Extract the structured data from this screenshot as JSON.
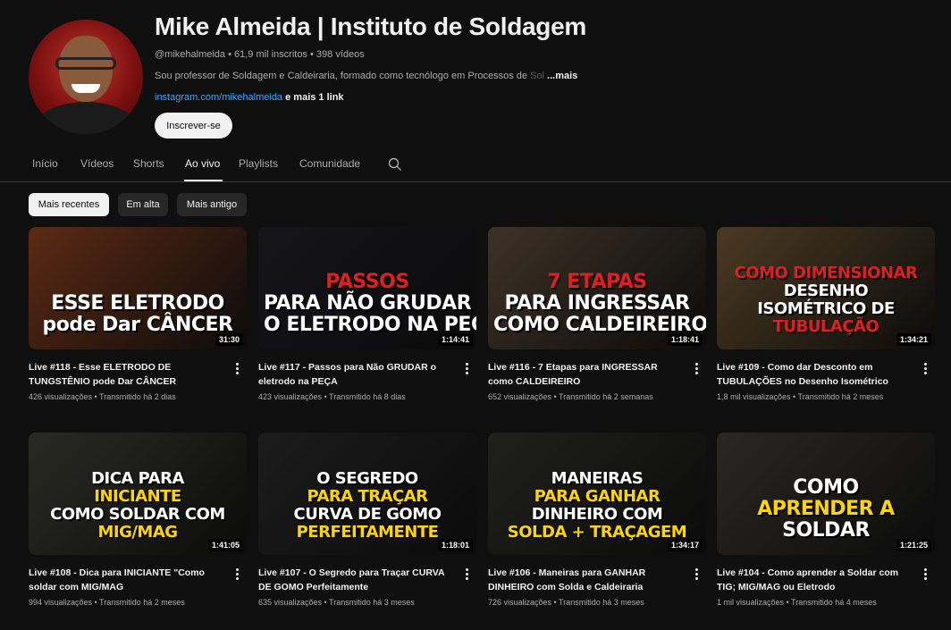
{
  "channel": {
    "name": "Mike Almeida | Instituto de Soldagem",
    "handle": "@mikehalmeida",
    "subscribers": "61,9 mil inscritos",
    "videos": "398 vídeos",
    "description": "Sou professor de Soldagem e Caldeiraria, formado como tecnólogo em Processos de",
    "description_fade": " Sol",
    "more_label": "...mais",
    "link": "instagram.com/mikehalmeida",
    "link_extra": "e mais 1 link",
    "subscribe_label": "Inscrever-se"
  },
  "tabs": [
    {
      "label": "Início"
    },
    {
      "label": "Vídeos"
    },
    {
      "label": "Shorts"
    },
    {
      "label": "Ao vivo"
    },
    {
      "label": "Playlists"
    },
    {
      "label": "Comunidade"
    }
  ],
  "active_tab": "Ao vivo",
  "chips": [
    {
      "label": "Mais recentes"
    },
    {
      "label": "Em alta"
    },
    {
      "label": "Mais antigo"
    }
  ],
  "videos": [
    {
      "title": "Live #118 - Esse ELETRODO DE TUNGSTÊNIO pode Dar CÂNCER",
      "views": "426 visualizações",
      "when": "Transmitido há 2 dias",
      "duration": "31:30",
      "thumb": {
        "bg": "#5c2a14",
        "lines": [
          {
            "text": "ESSE ELETRODO",
            "color": "#ffffff"
          },
          {
            "text": "pode Dar CÂNCER",
            "color": "#ffffff"
          }
        ]
      }
    },
    {
      "title": "Live #117 - Passos para Não GRUDAR o eletrodo na PEÇA",
      "views": "423 visualizações",
      "when": "Transmitido há 8 dias",
      "duration": "1:14:41",
      "thumb": {
        "bg": "#15151b",
        "lines": [
          {
            "text": "PASSOS",
            "color": "#e02020"
          },
          {
            "text": "PARA NÃO GRUDAR",
            "color": "#ffffff"
          },
          {
            "text": "O ELETRODO NA PEÇA",
            "color": "#ffffff"
          }
        ]
      }
    },
    {
      "title": "Live #116 - 7 Etapas para INGRESSAR como CALDEIREIRO",
      "views": "652 visualizações",
      "when": "Transmitido há 2 semanas",
      "duration": "1:18:41",
      "thumb": {
        "bg": "#3e3226",
        "lines": [
          {
            "text": "7 ETAPAS",
            "color": "#e02020"
          },
          {
            "text": "PARA INGRESSAR",
            "color": "#ffffff"
          },
          {
            "text": "COMO CALDEIREIRO",
            "color": "#ffffff"
          }
        ]
      }
    },
    {
      "title": "Live #109 - Como dar Desconto em TUBULAÇÕES no Desenho Isométrico",
      "views": "1,8 mil visualizações",
      "when": "Transmitido há 2 meses",
      "duration": "1:34:21",
      "thumb": {
        "bg": "#4a3a22",
        "lines": [
          {
            "text": "COMO DIMENSIONAR",
            "color": "#e02020"
          },
          {
            "text": "DESENHO",
            "color": "#ffffff"
          },
          {
            "text": "ISOMÉTRICO DE",
            "color": "#ffffff"
          },
          {
            "text": "TUBULAÇÃO",
            "color": "#e02020"
          }
        ]
      }
    },
    {
      "title": "Live #108 - Dica para INICIANTE \"Como soldar com MIG/MAG",
      "views": "994 visualizações",
      "when": "Transmitido há 2 meses",
      "duration": "1:41:05",
      "thumb": {
        "bg": "#2a2a24",
        "lines": [
          {
            "text": "DICA PARA",
            "color": "#ffffff"
          },
          {
            "text": "INICIANTE",
            "color": "#ffd500"
          },
          {
            "text": "COMO SOLDAR COM",
            "color": "#ffffff"
          },
          {
            "text": "MIG/MAG",
            "color": "#ffd500"
          }
        ]
      }
    },
    {
      "title": "Live #107 - O Segredo para Traçar CURVA DE GOMO Perfeitamente",
      "views": "635 visualizações",
      "when": "Transmitido há 3 meses",
      "duration": "1:18:01",
      "thumb": {
        "bg": "#1c1c1c",
        "lines": [
          {
            "text": "O SEGREDO",
            "color": "#ffffff"
          },
          {
            "text": "PARA TRAÇAR",
            "color": "#ffd500"
          },
          {
            "text": "CURVA DE GOMO",
            "color": "#ffffff"
          },
          {
            "text": "PERFEITAMENTE",
            "color": "#ffd500"
          }
        ]
      }
    },
    {
      "title": "Live #106 - Maneiras para GANHAR DINHEIRO com Solda e Caldeiraria",
      "views": "726 visualizações",
      "when": "Transmitido há 3 meses",
      "duration": "1:34:17",
      "thumb": {
        "bg": "#20201c",
        "lines": [
          {
            "text": "MANEIRAS",
            "color": "#ffffff"
          },
          {
            "text": "PARA GANHAR",
            "color": "#ffd500"
          },
          {
            "text": "DINHEIRO COM",
            "color": "#ffffff"
          },
          {
            "text": "SOLDA + TRAÇAGEM",
            "color": "#ffd500"
          }
        ]
      }
    },
    {
      "title": "Live #104 - Como aprender a Soldar com TIG; MIG/MAG ou Eletrodo",
      "views": "1 mil visualizações",
      "when": "Transmitido há 4 meses",
      "duration": "1:21:25",
      "thumb": {
        "bg": "#2a2826",
        "lines": [
          {
            "text": "COMO",
            "color": "#ffffff"
          },
          {
            "text": "APRENDER A",
            "color": "#ffd500"
          },
          {
            "text": "SOLDAR",
            "color": "#ffffff"
          }
        ]
      }
    }
  ]
}
